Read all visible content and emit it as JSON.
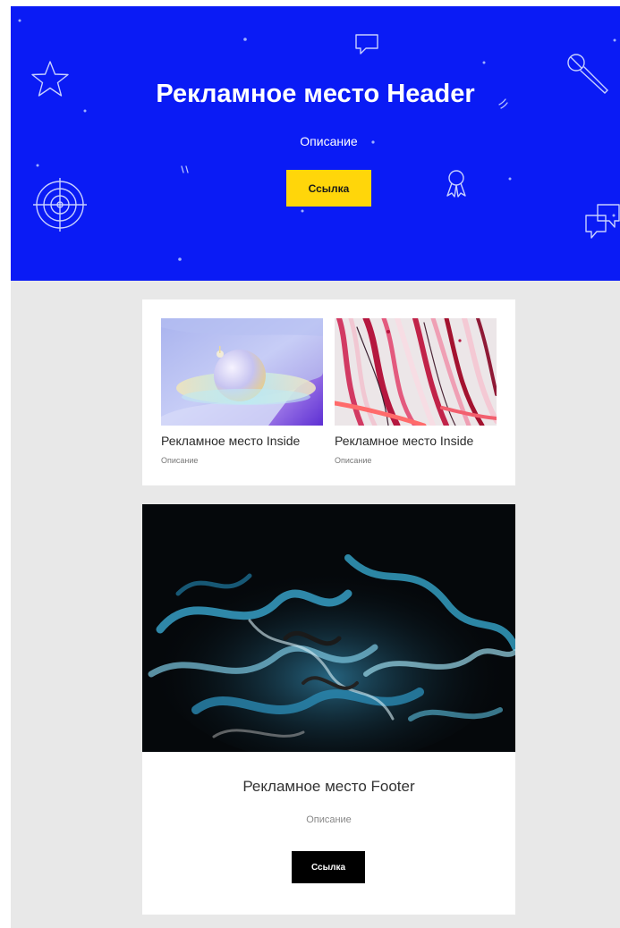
{
  "colors": {
    "hero_bg": "#0a1bf5",
    "accent_yellow": "#ffd60a",
    "footer_button": "#000000",
    "page_bg": "#e8e8e8"
  },
  "header": {
    "title": "Рекламное место Header",
    "description": "Описание",
    "button_label": "Ссылка",
    "icons": [
      "star-icon",
      "chat-bubble-icon",
      "microphone-icon",
      "target-icon",
      "award-ribbon-icon",
      "chat-bubbles-icon"
    ]
  },
  "inside": {
    "items": [
      {
        "title": "Рекламное место Inside",
        "description": "Описание",
        "image": "abstract-sphere-image"
      },
      {
        "title": "Рекламное место Inside",
        "description": "Описание",
        "image": "red-marble-paint-image"
      }
    ]
  },
  "footer": {
    "image": "blue-ink-smoke-image",
    "title": "Рекламное место Footer",
    "description": "Описание",
    "button_label": "Ссылка"
  }
}
